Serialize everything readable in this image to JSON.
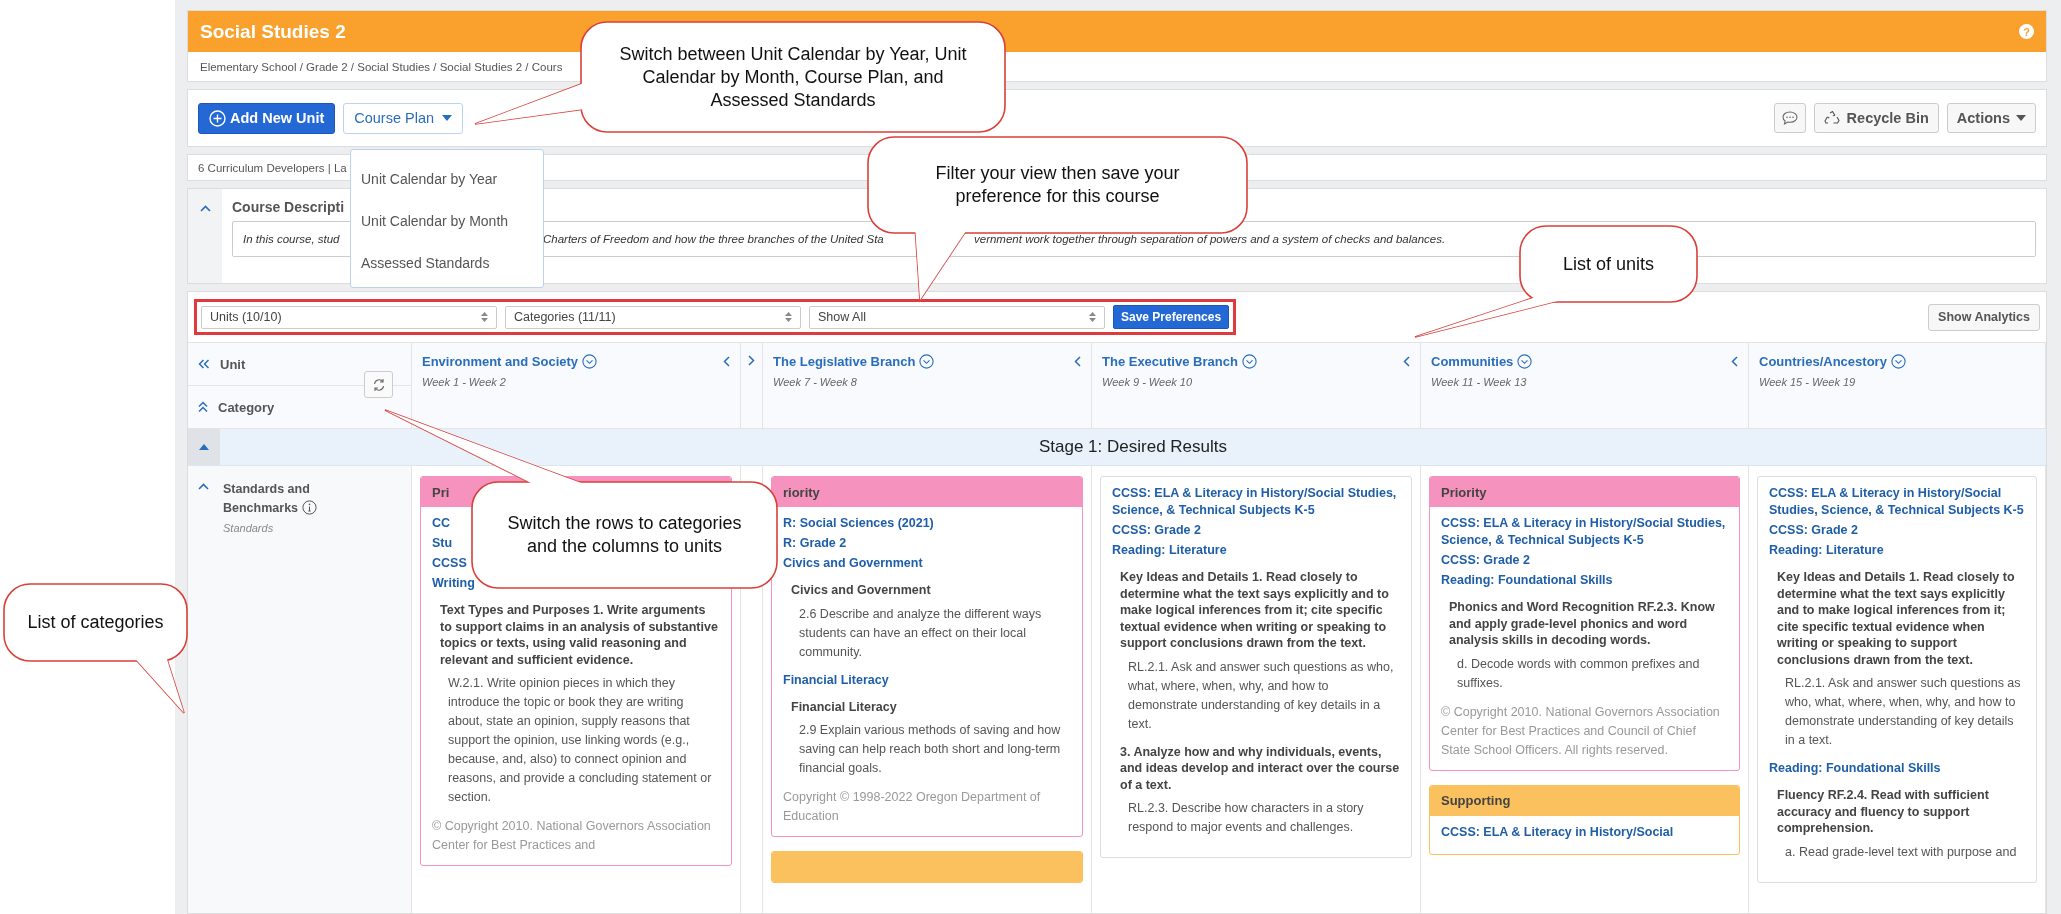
{
  "header": {
    "title": "Social Studies 2",
    "help": "?",
    "breadcrumb": "Elementary School / Grade 2 / Social Studies / Social Studies 2 / Cours"
  },
  "toolbar": {
    "add_button": "Add New Unit",
    "view_button": "Course Plan",
    "recycle_button": "Recycle Bin",
    "actions_button": "Actions"
  },
  "view_menu": {
    "items": [
      {
        "label": "Unit Calendar by Year"
      },
      {
        "label": "Unit Calendar by Month"
      },
      {
        "label": "Assessed Standards"
      }
    ]
  },
  "meta": "6 Curriculum Developers | La",
  "description": {
    "title": "Course Descripti",
    "parts": [
      "In this course, stud",
      "Charters of Freedom and how the three branches of the United Sta",
      "vernment work together through separation of powers and a system of checks and balances."
    ]
  },
  "filters": {
    "selects": [
      "Units (10/10)",
      "Categories (11/11)",
      "Show All"
    ],
    "save_button": "Save Preferences",
    "analytics_button": "Show Analytics"
  },
  "grid": {
    "unit_label": "Unit",
    "category_label": "Category",
    "stage": "Stage 1: Desired Results",
    "category": {
      "title": "Standards and Benchmarks",
      "subtitle": "Standards"
    },
    "units": [
      {
        "title": "Environment and Society",
        "weeks": "Week 1 - Week 2",
        "cards": [
          {
            "color": "#f592bd",
            "header": "Pri",
            "items": [
              {
                "kind": "link",
                "text": "CC"
              },
              {
                "kind": "link",
                "text": "Stu"
              },
              {
                "kind": "link",
                "text": "CCSS"
              },
              {
                "kind": "link",
                "text": "Writing"
              },
              {
                "kind": "heading",
                "text": "Text Types and Purposes 1. Write arguments to support claims in an analysis of substantive topics or texts, using valid reasoning and relevant and sufficient evidence."
              },
              {
                "kind": "text",
                "text": "W.2.1. Write opinion pieces in which they introduce the topic or book they are writing about, state an opinion, supply reasons that support the opinion, use linking words (e.g., because, and, also) to connect opinion and reasons, and provide a concluding statement or section."
              },
              {
                "kind": "copyright",
                "text": "© Copyright 2010. National Governors Association Center for Best Practices and"
              }
            ]
          }
        ]
      },
      {
        "title": "The Legislative Branch",
        "weeks": "Week 7 - Week 8",
        "cards": [
          {
            "color": "#f592bd",
            "header": "riority",
            "items": [
              {
                "kind": "link",
                "text": "R: Social Sciences (2021)"
              },
              {
                "kind": "link",
                "text": "R: Grade 2"
              },
              {
                "kind": "link",
                "text": "Civics and Government"
              },
              {
                "kind": "heading",
                "text": "Civics and Government"
              },
              {
                "kind": "text",
                "text": "2.6 Describe and analyze the different ways students can have an effect on their local community."
              },
              {
                "kind": "link",
                "text": "Financial Literacy"
              },
              {
                "kind": "heading",
                "text": "Financial Literacy"
              },
              {
                "kind": "text",
                "text": "2.9 Explain various methods of saving and how saving can help reach both short and long-term financial goals."
              },
              {
                "kind": "copyright",
                "text": "Copyright © 1998-2022 Oregon Department of Education"
              }
            ]
          },
          {
            "color": "#fbc15e"
          }
        ]
      },
      {
        "title": "The Executive Branch",
        "weeks": "Week 9 - Week 10",
        "cards": [
          {
            "items": [
              {
                "kind": "link",
                "text": "CCSS: ELA & Literacy in History/Social Studies, Science, & Technical Subjects K-5"
              },
              {
                "kind": "link",
                "text": "CCSS: Grade 2"
              },
              {
                "kind": "link",
                "text": "Reading: Literature"
              },
              {
                "kind": "heading",
                "text": "Key Ideas and Details 1. Read closely to determine what the text says explicitly and to make logical inferences from it; cite specific textual evidence when writing or speaking to support conclusions drawn from the text."
              },
              {
                "kind": "text",
                "text": "RL.2.1. Ask and answer such questions as who, what, where, when, why, and how to demonstrate understanding of key details in a text."
              },
              {
                "kind": "heading",
                "text": "3. Analyze how and why individuals, events, and ideas develop and interact over the course of a text."
              },
              {
                "kind": "text",
                "text": "RL.2.3. Describe how characters in a story respond to major events and challenges."
              }
            ]
          }
        ]
      },
      {
        "title": "Communities",
        "weeks": "Week 11 - Week 13",
        "cards": [
          {
            "color": "#f592bd",
            "header": "Priority",
            "items": [
              {
                "kind": "link",
                "text": "CCSS: ELA & Literacy in History/Social Studies, Science, & Technical Subjects K-5"
              },
              {
                "kind": "link",
                "text": "CCSS: Grade 2"
              },
              {
                "kind": "link",
                "text": "Reading: Foundational Skills"
              },
              {
                "kind": "heading",
                "text": "Phonics and Word Recognition RF.2.3. Know and apply grade-level phonics and word analysis skills in decoding words."
              },
              {
                "kind": "text",
                "text": "d. Decode words with common prefixes and suffixes."
              },
              {
                "kind": "copyright",
                "text": "© Copyright 2010. National Governors Association Center for Best Practices and Council of Chief State School Officers. All rights reserved."
              }
            ]
          },
          {
            "color": "#fbc15e",
            "header": "Supporting",
            "items": [
              {
                "kind": "link",
                "text": "CCSS: ELA & Literacy in History/Social"
              }
            ]
          }
        ]
      },
      {
        "title": "Countries/Ancestory",
        "weeks": "Week 15 - Week 19",
        "cards": [
          {
            "items": [
              {
                "kind": "link",
                "text": "CCSS: ELA & Literacy in History/Social Studies, Science, & Technical Subjects K-5"
              },
              {
                "kind": "link",
                "text": "CCSS: Grade 2"
              },
              {
                "kind": "link",
                "text": "Reading: Literature"
              },
              {
                "kind": "heading",
                "text": "Key Ideas and Details 1. Read closely to determine what the text says explicitly and to make logical inferences from it; cite specific textual evidence when writing or speaking to support conclusions drawn from the text."
              },
              {
                "kind": "text",
                "text": "RL.2.1. Ask and answer such questions as who, what, where, when, why, and how to demonstrate understanding of key details in a text."
              },
              {
                "kind": "link",
                "text": "Reading: Foundational Skills"
              },
              {
                "kind": "heading",
                "text": "Fluency RF.2.4. Read with sufficient accuracy and fluency to support comprehension."
              },
              {
                "kind": "text",
                "text": "a. Read grade-level text with purpose and"
              }
            ]
          }
        ]
      }
    ]
  },
  "callouts": [
    {
      "text": "Switch between Unit Calendar by Year, Unit Calendar by Month, Course Plan, and Assessed Standards"
    },
    {
      "text": "Filter your view then save your preference for this course"
    },
    {
      "text": "List of units"
    },
    {
      "text": "Switch the rows to categories and the columns to units"
    },
    {
      "text": "List of categories"
    }
  ]
}
